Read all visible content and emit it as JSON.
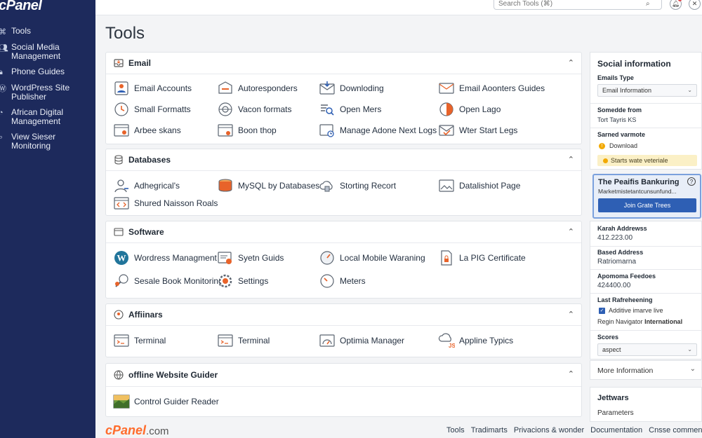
{
  "app": {
    "logo": "cPanel",
    "page_title": "Tools"
  },
  "sidebar": {
    "items": [
      {
        "label": "Tools",
        "icon": "tools-icon"
      },
      {
        "label": "Social Media Management",
        "icon": "users-icon"
      },
      {
        "label": "Phone Guides",
        "icon": "lock-icon"
      },
      {
        "label": "WordPress Site Publisher",
        "icon": "wordpress-icon"
      },
      {
        "label": "African Digital Management",
        "icon": "gauge-icon"
      },
      {
        "label": "View Sieser Monitoring",
        "icon": "magnify-icon"
      }
    ]
  },
  "topbar": {
    "search_placeholder": "Search Tools (⌘)"
  },
  "sections": {
    "email": {
      "title": "Email",
      "tools": [
        "Email Accounts",
        "Autoresponders",
        "Downloding",
        "Email Aoonters Guides",
        "Small Formatts",
        "Vacon formats",
        "Open Mers",
        "Open Lago",
        "Arbee skans",
        "Boon thop",
        "Manage Adone Next Logs",
        "Wter Start Legs"
      ]
    },
    "databases": {
      "title": "Databases",
      "tools": [
        "Adhegrical's",
        "MySQL by Databases",
        "Storting Recort",
        "Datalishiot Page",
        "Shured Naisson Roals"
      ]
    },
    "software": {
      "title": "Software",
      "tools": [
        "Wordress Managment",
        "Syetn Guids",
        "Local Mobile Waraning",
        "La PIG Certificate",
        "Sesale Book Monitoring",
        "Settings",
        "Meters"
      ]
    },
    "affiliates": {
      "title": "Affiinars",
      "tools": [
        "Terminal",
        "Terminal",
        "Optimia Manager",
        "Appline Typics"
      ]
    },
    "website": {
      "title": "offline Website Guider",
      "tools": [
        "Control Guider Reader"
      ]
    }
  },
  "right": {
    "social_title": "Social information",
    "emails_type_label": "Emails Type",
    "emails_type_value": "Email Information",
    "somedde_label": "Somedde from",
    "somedde_value": "Tort Tayris KS",
    "sarned_label": "Sarned varmote",
    "download_label": "Download",
    "starts_label": "Starts wate veteriale",
    "promo_title": "The Peaifis Bankuring",
    "promo_text": "Marketmistetantcunsunfund...",
    "promo_button": "Join Grate Trees",
    "karah_label": "Karah Addrewss",
    "karah_value": "412.223.00",
    "based_label": "Based Address",
    "based_value": "Ratriomarna",
    "apomoma_label": "Apomoma Feedoes",
    "apomoma_value": "424400.00",
    "last_label": "Last Rafreheening",
    "additive_label": "Additive imarve live",
    "regin_prefix": "Regin Navigator",
    "regin_value": "International",
    "scores_label": "Scores",
    "scores_value": "aspect",
    "more_info": "More Information",
    "jettwars_title": "Jettwars",
    "parameters": "Parameters"
  },
  "footer": {
    "logo_main": "cPanel",
    "logo_suffix": ".com",
    "links": [
      "Tools",
      "Tradimarts",
      "Privacions & wonder",
      "Documentation",
      "Cnsse comments"
    ]
  },
  "colors": {
    "sidebar": "#1d2a5c",
    "accent_orange": "#ff6c2c",
    "button_blue": "#2e5fb4"
  }
}
